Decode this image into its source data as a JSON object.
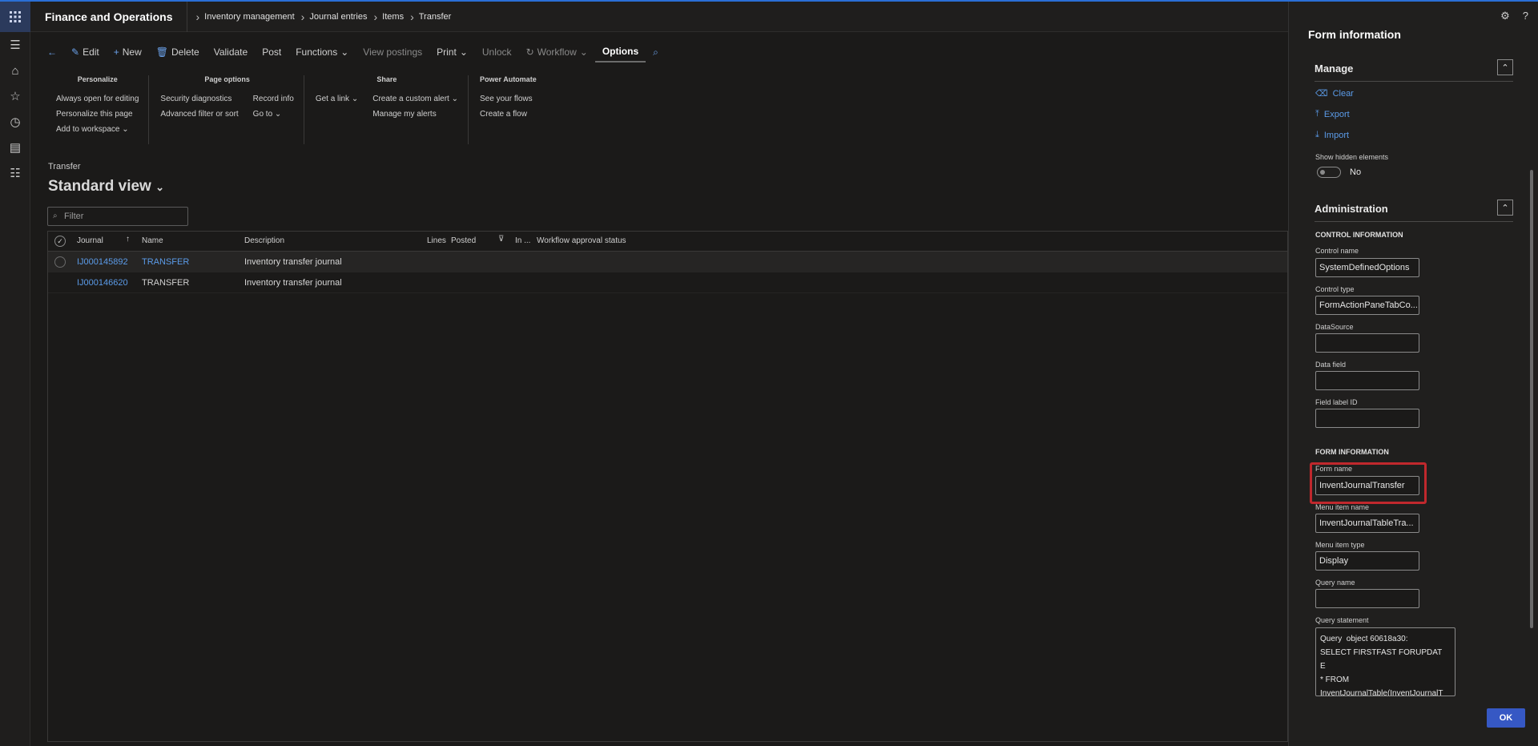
{
  "app": {
    "title": "Finance and Operations"
  },
  "breadcrumbs": [
    "Inventory management",
    "Journal entries",
    "Items",
    "Transfer"
  ],
  "rail_icons": [
    "waffle-icon",
    "hamburger-icon",
    "home-icon",
    "star-icon",
    "clock-icon",
    "workspace-icon",
    "list-icon"
  ],
  "actions": {
    "edit": "Edit",
    "new": "New",
    "delete": "Delete",
    "validate": "Validate",
    "post": "Post",
    "functions": "Functions",
    "view_postings": "View postings",
    "print": "Print",
    "unlock": "Unlock",
    "workflow": "Workflow",
    "options": "Options"
  },
  "ribbon": {
    "personalize": {
      "title": "Personalize",
      "items": [
        "Always open for editing",
        "Personalize this page",
        "Add to workspace"
      ]
    },
    "page_options": {
      "title": "Page options",
      "col1": [
        "Security diagnostics",
        "Advanced filter or sort"
      ],
      "col2": [
        "Record info",
        "Go to"
      ]
    },
    "share": {
      "title": "Share",
      "col1": [
        "Get a link"
      ],
      "col2": [
        "Create a custom alert",
        "Manage my alerts"
      ]
    },
    "power_automate": {
      "title": "Power Automate",
      "items": [
        "See your flows",
        "Create a flow"
      ]
    }
  },
  "page": {
    "label": "Transfer",
    "view": "Standard view",
    "filter_placeholder": "Filter"
  },
  "grid": {
    "headers": {
      "journal": "Journal",
      "name": "Name",
      "description": "Description",
      "lines": "Lines",
      "posted": "Posted",
      "in": "In ...",
      "workflow": "Workflow approval status"
    },
    "rows": [
      {
        "journal": "IJ000145892",
        "name": "TRANSFER",
        "description": "Inventory transfer journal"
      },
      {
        "journal": "IJ000146620",
        "name": "TRANSFER",
        "description": "Inventory transfer journal"
      }
    ]
  },
  "pane": {
    "title": "Form information",
    "manage": {
      "title": "Manage",
      "clear": "Clear",
      "export": "Export",
      "import": "Import"
    },
    "show_hidden_label": "Show hidden elements",
    "show_hidden_value": "No",
    "admin": {
      "title": "Administration"
    },
    "control_info": "CONTROL INFORMATION",
    "control_name_label": "Control name",
    "control_name": "SystemDefinedOptions",
    "control_type_label": "Control type",
    "control_type": "FormActionPaneTabCo...",
    "datasource_label": "DataSource",
    "datasource": "",
    "data_field_label": "Data field",
    "data_field": "",
    "field_label_id_label": "Field label ID",
    "field_label_id": "",
    "form_info": "FORM INFORMATION",
    "form_name_label": "Form name",
    "form_name": "InventJournalTransfer",
    "menu_item_name_label": "Menu item name",
    "menu_item_name": "InventJournalTableTra...",
    "menu_item_type_label": "Menu item type",
    "menu_item_type": "Display",
    "query_name_label": "Query name",
    "query_name": "",
    "query_statement_label": "Query statement",
    "query_statement": "Query  object 60618a30:\nSELECT FIRSTFAST FORUPDATE\n* FROM\nInventJournalTable(InventJournalTable) USING INDEX",
    "ok": "OK"
  },
  "colors": {
    "accent": "#2a6fd6",
    "link": "#5b9be8",
    "ok": "#3658c4",
    "highlight": "#c0282d"
  }
}
